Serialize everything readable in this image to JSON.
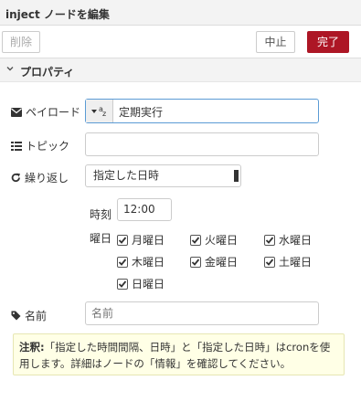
{
  "tray": {
    "title": "inject ノードを編集"
  },
  "toolbar": {
    "delete_label": "削除",
    "cancel_label": "中止",
    "done_label": "完了"
  },
  "section": {
    "title": "プロパティ"
  },
  "payload": {
    "label": "ペイロード",
    "type_icon": "az-string-icon",
    "value": "定期実行"
  },
  "topic": {
    "label": "トピック",
    "value": ""
  },
  "repeat": {
    "label": "繰り返し",
    "selected": "指定した日時"
  },
  "time": {
    "label": "時刻",
    "value": "12:00"
  },
  "days": {
    "label": "曜日",
    "items": [
      {
        "label": "月曜日",
        "checked": true
      },
      {
        "label": "火曜日",
        "checked": true
      },
      {
        "label": "水曜日",
        "checked": true
      },
      {
        "label": "木曜日",
        "checked": true
      },
      {
        "label": "金曜日",
        "checked": true
      },
      {
        "label": "土曜日",
        "checked": true
      },
      {
        "label": "日曜日",
        "checked": true
      }
    ]
  },
  "name": {
    "label": "名前",
    "placeholder": "名前",
    "value": ""
  },
  "tip": {
    "bold": "注釈:",
    "text": "「指定した時間間隔、日時」と「指定した日時」はcronを使用します。詳細はノードの「情報」を確認してください。"
  },
  "colors": {
    "accent": "#ad1625",
    "tip_bg": "#ffffe6",
    "focus": "#5b9bd5"
  }
}
